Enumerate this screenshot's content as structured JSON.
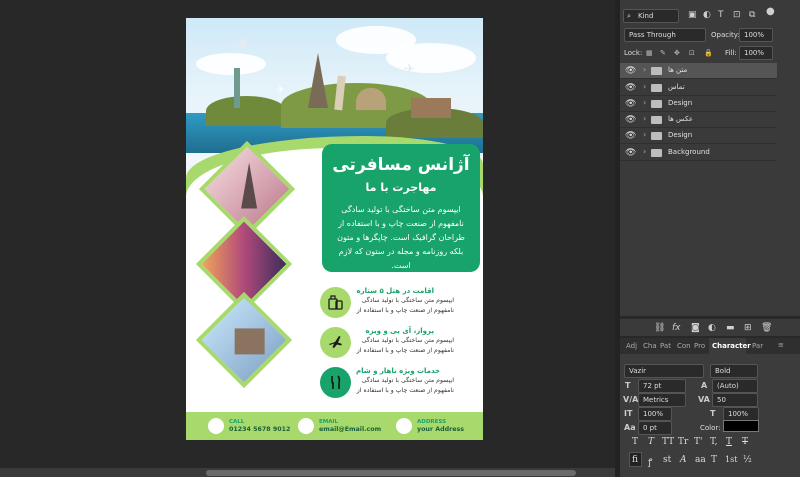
{
  "flyer": {
    "title": "آژانس مسافرتی",
    "subtitle": "مهاجرت با ما",
    "body": "ایپسوم متن ساختگی با تولید سادگی نامفهوم از صنعت چاپ و با استفاده از طراحان گرافیک است. چاپگرها و متون بلکه روزنامه و مجله در ستون که لازم است.",
    "features": [
      {
        "title": "اقامت در هتل ۵ ستاره",
        "desc": "ایپسوم متن ساختگی با تولید سادگی نامفهوم از صنعت چاپ و با استفاده از",
        "icon": "luggage-icon",
        "color": "#a7d96d"
      },
      {
        "title": "پرواز، آی پی و ویزه",
        "desc": "ایپسوم متن ساختگی با تولید سادگی نامفهوم از صنعت چاپ و با استفاده از",
        "icon": "airplane-icon",
        "color": "#a7d96d"
      },
      {
        "title": "خدمات ویژه ناهار و شام",
        "desc": "ایپسوم متن ساختگی با تولید سادگی نامفهوم از صنعت چاپ و با استفاده از",
        "icon": "cutlery-icon",
        "color": "#18a36a"
      }
    ],
    "footer": {
      "call_label": "CALL",
      "call_value": "01234 5678 9012",
      "email_label": "EMAIL",
      "email_value": "email@Email.com",
      "address_label": "ADDRESS",
      "address_value": "your Address"
    }
  },
  "layers_panel": {
    "kind": "Kind",
    "blend_mode": "Pass Through",
    "opacity_label": "Opacity:",
    "opacity_value": "100%",
    "lock_label": "Lock:",
    "fill_label": "Fill:",
    "fill_value": "100%",
    "layers": [
      {
        "name": "متن ها",
        "selected": true
      },
      {
        "name": "تماس",
        "selected": false
      },
      {
        "name": "Design",
        "selected": false
      },
      {
        "name": "عکس ها",
        "selected": false
      },
      {
        "name": "Design",
        "selected": false
      },
      {
        "name": "Background",
        "selected": false
      }
    ]
  },
  "character_panel": {
    "tabs": [
      "Adj",
      "Cha",
      "Pat",
      "Con",
      "Pro",
      "Character",
      "Par"
    ],
    "font_family": "Vazir",
    "font_style": "Bold",
    "font_size": "72 pt",
    "leading": "(Auto)",
    "kerning": "Metrics",
    "tracking": "50",
    "vertical_scale": "100%",
    "horizontal_scale": "100%",
    "baseline_shift": "0 pt",
    "color_label": "Color:",
    "color_value": "#000000",
    "type_buttons_row1": [
      "T",
      "T",
      "TT",
      "Tr",
      "T'",
      "T,",
      "T",
      "T"
    ],
    "type_buttons_row2": [
      "fi",
      "ꝭ",
      "st",
      "A",
      "aa",
      "T",
      "1st",
      "½"
    ]
  }
}
